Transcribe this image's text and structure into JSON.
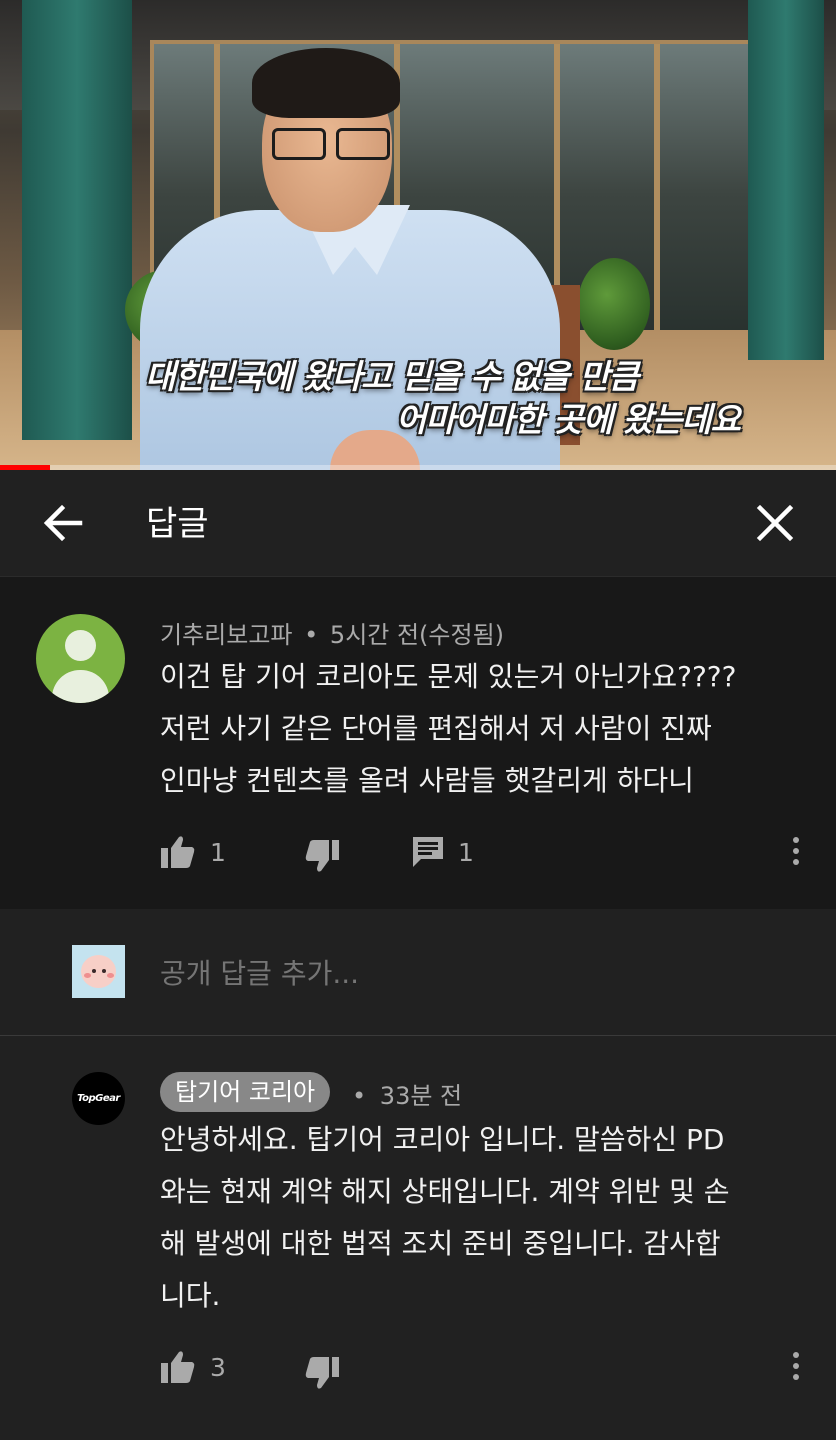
{
  "video": {
    "subtitle_line1": "대한민국에 왔다고 믿을 수 없을 만큼",
    "subtitle_line2": "어마어마한 곳에 왔는데요",
    "progress": 0.06,
    "progress_color": "#ff0000"
  },
  "header": {
    "back_icon": "arrow-left-icon",
    "title": "답글",
    "close_icon": "close-icon"
  },
  "parent_comment": {
    "author": "기추리보고파",
    "separator": "•",
    "time": "5시간 전(수정됨)",
    "avatar_color": "#7cb342",
    "lines": [
      "이건 탑 기어 코리아도 문제 있는거 아닌가요????",
      "저런 사기 같은 단어를 편집해서 저 사람이 진짜",
      "인마냥 컨텐츠를 올려 사람들 햇갈리게 하다니"
    ],
    "likes": "1",
    "replies": "1"
  },
  "add_reply": {
    "placeholder": "공개 답글 추가..."
  },
  "reply_comment": {
    "author": "탑기어 코리아",
    "separator": "•",
    "time": "33분 전",
    "avatar_text": "TopGear",
    "lines": [
      "안녕하세요. 탑기어 코리아 입니다. 말씀하신 PD",
      "와는 현재 계약 해지 상태입니다. 계약 위반 및 손",
      "해 발생에 대한 법적 조치 준비 중입니다. 감사합",
      "니다."
    ],
    "likes": "3"
  }
}
